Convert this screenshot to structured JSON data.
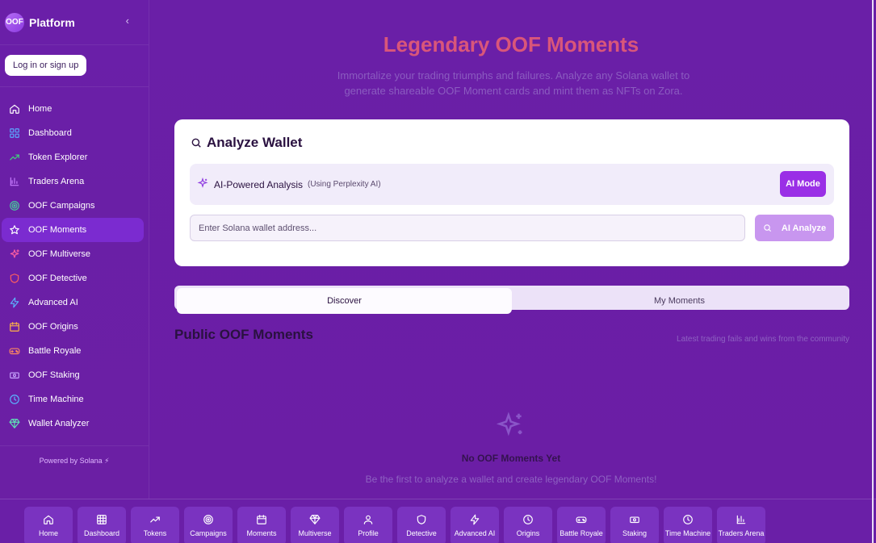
{
  "brand": {
    "logo": "OOF",
    "name": "Platform",
    "collapse_icon": "chevron-left-icon"
  },
  "auth": {
    "login_label": "Log in or sign up"
  },
  "sidebar": {
    "items": [
      {
        "label": "Home",
        "icon": "home-icon",
        "color": "#ffffff"
      },
      {
        "label": "Dashboard",
        "icon": "dashboard-icon",
        "color": "#5aa8ff"
      },
      {
        "label": "Token Explorer",
        "icon": "trending-up-icon",
        "color": "#40d27a"
      },
      {
        "label": "Traders Arena",
        "icon": "bar-chart-icon",
        "color": "#c77dff"
      },
      {
        "label": "OOF Campaigns",
        "icon": "target-icon",
        "color": "#44d19a"
      },
      {
        "label": "OOF Moments",
        "icon": "star-icon",
        "color": "#ffffff",
        "active": true
      },
      {
        "label": "OOF Multiverse",
        "icon": "sparkles-icon",
        "color": "#ff5fa2"
      },
      {
        "label": "OOF Detective",
        "icon": "shield-icon",
        "color": "#ff5f5f"
      },
      {
        "label": "Advanced AI",
        "icon": "zap-icon",
        "color": "#5ab5ff"
      },
      {
        "label": "OOF Origins",
        "icon": "calendar-icon",
        "color": "#ffb347"
      },
      {
        "label": "Battle Royale",
        "icon": "gamepad-icon",
        "color": "#ff8a5f"
      },
      {
        "label": "OOF Staking",
        "icon": "coins-icon",
        "color": "#c9a6ff"
      },
      {
        "label": "Time Machine",
        "icon": "clock-icon",
        "color": "#5ab5ff"
      },
      {
        "label": "Wallet Analyzer",
        "icon": "gem-icon",
        "color": "#5fe0b5"
      }
    ],
    "footer": "Powered by Solana ⚡"
  },
  "hero": {
    "title": "Legendary OOF Moments",
    "subtitle": "Immortalize your trading triumphs and failures. Analyze any Solana wallet to generate shareable OOF Moment cards and mint them as NFTs on Zora."
  },
  "analyze": {
    "title": "Analyze Wallet",
    "ai_label": "AI-Powered Analysis",
    "ai_note": "(Using Perplexity AI)",
    "ai_mode_label": "AI Mode",
    "input_placeholder": "Enter Solana wallet address...",
    "analyze_label": "AI Analyze"
  },
  "tabs": [
    {
      "label": "Discover",
      "active": true
    },
    {
      "label": "My Moments",
      "active": false
    }
  ],
  "moments": {
    "title": "Public OOF Moments",
    "note": "Latest trading fails and wins from the community",
    "empty_title": "No OOF Moments Yet",
    "empty_sub": "Be the first to analyze a wallet and create legendary OOF Moments!"
  },
  "bottom_nav": [
    {
      "label": "Home",
      "icon": "home-icon"
    },
    {
      "label": "Dashboard",
      "icon": "grid-icon"
    },
    {
      "label": "Tokens",
      "icon": "trending-up-icon"
    },
    {
      "label": "Campaigns",
      "icon": "target-icon"
    },
    {
      "label": "Moments",
      "icon": "calendar-icon"
    },
    {
      "label": "Multiverse",
      "icon": "gem-icon"
    },
    {
      "label": "Profile",
      "icon": "user-icon"
    },
    {
      "label": "Detective",
      "icon": "shield-icon"
    },
    {
      "label": "Advanced AI",
      "icon": "zap-icon"
    },
    {
      "label": "Origins",
      "icon": "clock-icon"
    },
    {
      "label": "Battle Royale",
      "icon": "gamepad-icon"
    },
    {
      "label": "Staking",
      "icon": "coins-icon"
    },
    {
      "label": "Time Machine",
      "icon": "clock-icon"
    },
    {
      "label": "Traders Arena",
      "icon": "bar-chart-icon"
    }
  ]
}
